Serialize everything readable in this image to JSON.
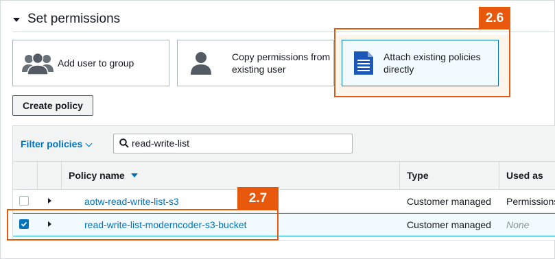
{
  "section": {
    "title": "Set permissions"
  },
  "options": [
    {
      "label": "Add user to group",
      "icon": "user-group-icon"
    },
    {
      "label_line1": "Copy permissions from",
      "label_line2": "existing user",
      "icon": "user-icon"
    },
    {
      "label_line1": "Attach existing policies",
      "label_line2": "directly",
      "icon": "document-icon",
      "selected": true
    }
  ],
  "annotations": {
    "tag_a": "2.6",
    "tag_b": "2.7",
    "accent": "#e8580c"
  },
  "create_policy_label": "Create policy",
  "filter": {
    "label": "Filter policies",
    "search_value": "read-write-list"
  },
  "table": {
    "headers": {
      "policy_name": "Policy name",
      "type": "Type",
      "used_as": "Used as"
    },
    "rows": [
      {
        "name": "aotw-read-write-list-s3",
        "type": "Customer managed",
        "used_as": "Permissions",
        "checked": false
      },
      {
        "name": "read-write-list-moderncoder-s3-bucket",
        "type": "Customer managed",
        "used_as": "None",
        "checked": true
      }
    ]
  },
  "colors": {
    "link": "#0073bb",
    "selected_border": "#0073bb"
  }
}
